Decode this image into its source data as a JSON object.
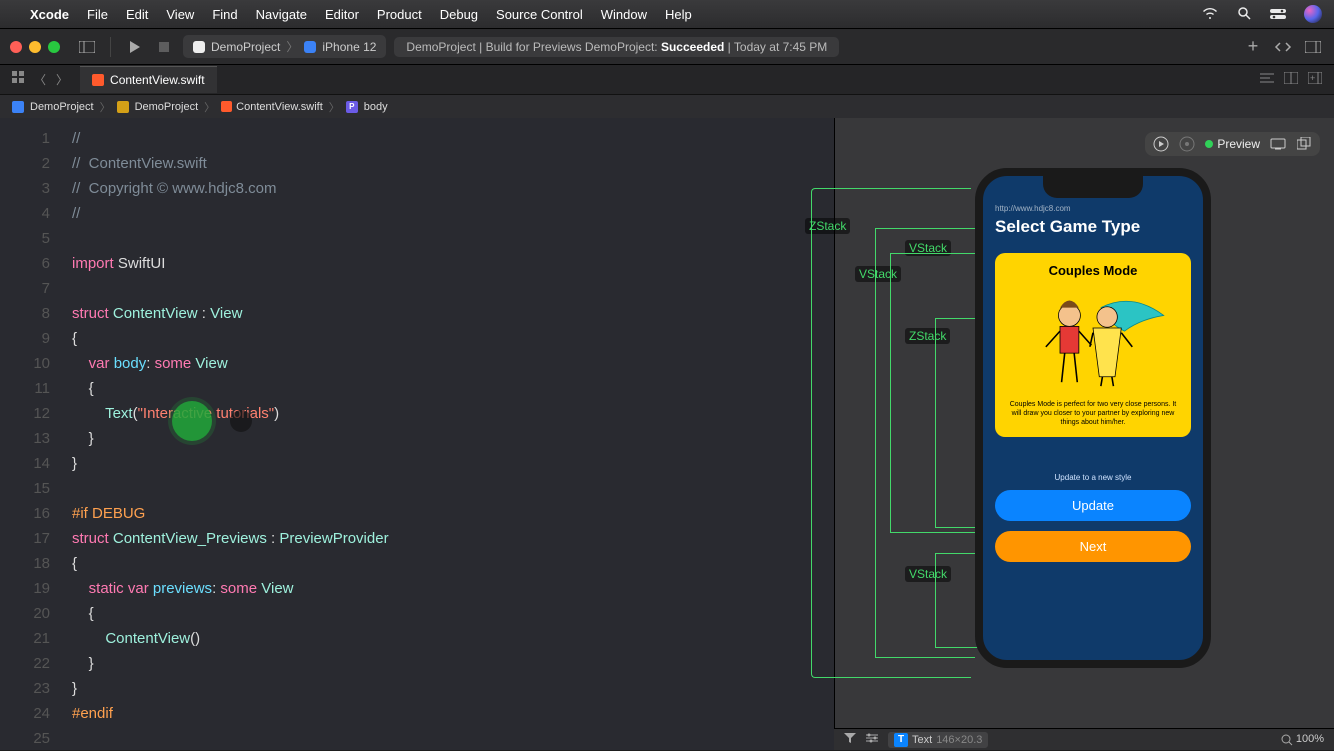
{
  "menubar": {
    "app": "Xcode",
    "items": [
      "File",
      "Edit",
      "View",
      "Find",
      "Navigate",
      "Editor",
      "Product",
      "Debug",
      "Source Control",
      "Window",
      "Help"
    ]
  },
  "toolbar": {
    "scheme_app": "DemoProject",
    "scheme_dev": "iPhone 12",
    "status_prefix": "DemoProject | Build for Previews DemoProject: ",
    "status_result": "Succeeded",
    "status_suffix": " | Today at 7:45 PM"
  },
  "tab": {
    "file": "ContentView.swift"
  },
  "breadcrumb": [
    "DemoProject",
    "DemoProject",
    "ContentView.swift",
    "body"
  ],
  "code": {
    "lines": [
      {
        "n": 1,
        "seg": [
          {
            "c": "c-comment",
            "t": "//"
          }
        ]
      },
      {
        "n": 2,
        "seg": [
          {
            "c": "c-comment",
            "t": "//  ContentView.swift"
          }
        ]
      },
      {
        "n": 3,
        "seg": [
          {
            "c": "c-comment",
            "t": "//  Copyright © www.hdjc8.com"
          }
        ]
      },
      {
        "n": 4,
        "seg": [
          {
            "c": "c-comment",
            "t": "//"
          }
        ]
      },
      {
        "n": 5,
        "seg": []
      },
      {
        "n": 6,
        "seg": [
          {
            "c": "c-key",
            "t": "import"
          },
          {
            "c": "",
            "t": " SwiftUI"
          }
        ]
      },
      {
        "n": 7,
        "seg": []
      },
      {
        "n": 8,
        "seg": [
          {
            "c": "c-key",
            "t": "struct"
          },
          {
            "c": "",
            "t": " "
          },
          {
            "c": "c-type",
            "t": "ContentView"
          },
          {
            "c": "",
            "t": " : "
          },
          {
            "c": "c-type",
            "t": "View"
          }
        ]
      },
      {
        "n": 9,
        "seg": [
          {
            "c": "",
            "t": "{"
          }
        ]
      },
      {
        "n": 10,
        "seg": [
          {
            "c": "",
            "t": "    "
          },
          {
            "c": "c-key",
            "t": "var"
          },
          {
            "c": "",
            "t": " "
          },
          {
            "c": "c-id",
            "t": "body"
          },
          {
            "c": "",
            "t": ": "
          },
          {
            "c": "c-key",
            "t": "some"
          },
          {
            "c": "",
            "t": " "
          },
          {
            "c": "c-type",
            "t": "View"
          }
        ]
      },
      {
        "n": 11,
        "seg": [
          {
            "c": "",
            "t": "    {"
          }
        ]
      },
      {
        "n": 12,
        "seg": [
          {
            "c": "",
            "t": "        "
          },
          {
            "c": "c-type",
            "t": "Text"
          },
          {
            "c": "",
            "t": "("
          },
          {
            "c": "c-str",
            "t": "\"Interactive tutorials\""
          },
          {
            "c": "",
            "t": ")"
          }
        ]
      },
      {
        "n": 13,
        "seg": [
          {
            "c": "",
            "t": "    }"
          }
        ]
      },
      {
        "n": 14,
        "seg": [
          {
            "c": "",
            "t": "}"
          }
        ]
      },
      {
        "n": 15,
        "seg": []
      },
      {
        "n": 16,
        "seg": [
          {
            "c": "c-pp",
            "t": "#if DEBUG"
          }
        ]
      },
      {
        "n": 17,
        "seg": [
          {
            "c": "c-key",
            "t": "struct"
          },
          {
            "c": "",
            "t": " "
          },
          {
            "c": "c-type",
            "t": "ContentView_Previews"
          },
          {
            "c": "",
            "t": " : "
          },
          {
            "c": "c-type",
            "t": "PreviewProvider"
          }
        ]
      },
      {
        "n": 18,
        "seg": [
          {
            "c": "",
            "t": "{"
          }
        ]
      },
      {
        "n": 19,
        "seg": [
          {
            "c": "",
            "t": "    "
          },
          {
            "c": "c-key",
            "t": "static"
          },
          {
            "c": "",
            "t": " "
          },
          {
            "c": "c-key",
            "t": "var"
          },
          {
            "c": "",
            "t": " "
          },
          {
            "c": "c-id",
            "t": "previews"
          },
          {
            "c": "",
            "t": ": "
          },
          {
            "c": "c-key",
            "t": "some"
          },
          {
            "c": "",
            "t": " "
          },
          {
            "c": "c-type",
            "t": "View"
          }
        ]
      },
      {
        "n": 20,
        "seg": [
          {
            "c": "",
            "t": "    {"
          }
        ]
      },
      {
        "n": 21,
        "seg": [
          {
            "c": "",
            "t": "        "
          },
          {
            "c": "c-type",
            "t": "ContentView"
          },
          {
            "c": "",
            "t": "()"
          }
        ]
      },
      {
        "n": 22,
        "seg": [
          {
            "c": "",
            "t": "    }"
          }
        ]
      },
      {
        "n": 23,
        "seg": [
          {
            "c": "",
            "t": "}"
          }
        ]
      },
      {
        "n": 24,
        "seg": [
          {
            "c": "c-pp",
            "t": "#endif"
          }
        ]
      },
      {
        "n": 25,
        "seg": []
      }
    ]
  },
  "preview": {
    "controls_label": "Preview",
    "url": "http://www.hdjc8.com",
    "title": "Select Game Type",
    "card_title": "Couples Mode",
    "card_desc": "Couples Mode is perfect for two very close persons. It will draw you closer to your partner by exploring new things about him/her.",
    "hint": "Update to a new style",
    "btn_update": "Update",
    "btn_next": "Next",
    "stacks": [
      "ZStack",
      "VStack",
      "VStack",
      "ZStack",
      "VStack"
    ]
  },
  "bottombar": {
    "sel_type": "Text",
    "sel_dims": "146×20.3",
    "zoom": "100%"
  }
}
